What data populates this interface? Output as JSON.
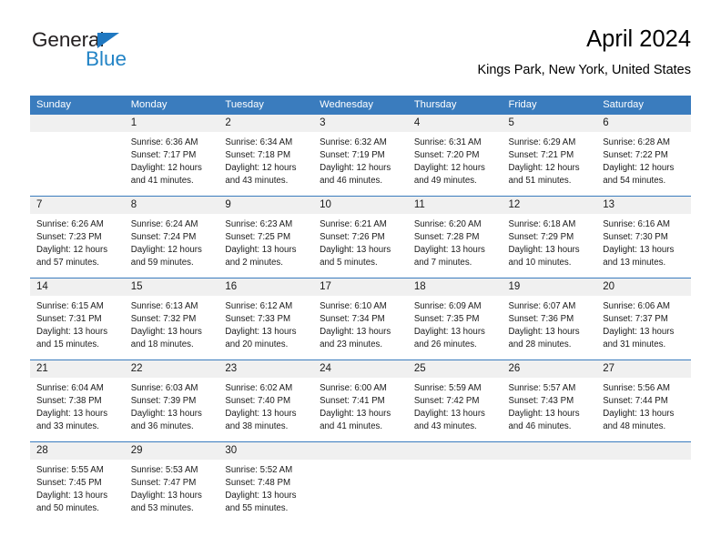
{
  "brand": {
    "name_top": "General",
    "name_bottom": "Blue"
  },
  "header": {
    "title": "April 2024",
    "location": "Kings Park, New York, United States"
  },
  "colors": {
    "header_blue": "#3a7cbe",
    "logo_blue": "#2384c6",
    "daynum_bg": "#f0f0f0"
  },
  "weekday_headers": [
    "Sunday",
    "Monday",
    "Tuesday",
    "Wednesday",
    "Thursday",
    "Friday",
    "Saturday"
  ],
  "weeks": [
    [
      {
        "day": "",
        "sunrise": "",
        "sunset": "",
        "daylight1": "",
        "daylight2": ""
      },
      {
        "day": "1",
        "sunrise": "Sunrise: 6:36 AM",
        "sunset": "Sunset: 7:17 PM",
        "daylight1": "Daylight: 12 hours",
        "daylight2": "and 41 minutes."
      },
      {
        "day": "2",
        "sunrise": "Sunrise: 6:34 AM",
        "sunset": "Sunset: 7:18 PM",
        "daylight1": "Daylight: 12 hours",
        "daylight2": "and 43 minutes."
      },
      {
        "day": "3",
        "sunrise": "Sunrise: 6:32 AM",
        "sunset": "Sunset: 7:19 PM",
        "daylight1": "Daylight: 12 hours",
        "daylight2": "and 46 minutes."
      },
      {
        "day": "4",
        "sunrise": "Sunrise: 6:31 AM",
        "sunset": "Sunset: 7:20 PM",
        "daylight1": "Daylight: 12 hours",
        "daylight2": "and 49 minutes."
      },
      {
        "day": "5",
        "sunrise": "Sunrise: 6:29 AM",
        "sunset": "Sunset: 7:21 PM",
        "daylight1": "Daylight: 12 hours",
        "daylight2": "and 51 minutes."
      },
      {
        "day": "6",
        "sunrise": "Sunrise: 6:28 AM",
        "sunset": "Sunset: 7:22 PM",
        "daylight1": "Daylight: 12 hours",
        "daylight2": "and 54 minutes."
      }
    ],
    [
      {
        "day": "7",
        "sunrise": "Sunrise: 6:26 AM",
        "sunset": "Sunset: 7:23 PM",
        "daylight1": "Daylight: 12 hours",
        "daylight2": "and 57 minutes."
      },
      {
        "day": "8",
        "sunrise": "Sunrise: 6:24 AM",
        "sunset": "Sunset: 7:24 PM",
        "daylight1": "Daylight: 12 hours",
        "daylight2": "and 59 minutes."
      },
      {
        "day": "9",
        "sunrise": "Sunrise: 6:23 AM",
        "sunset": "Sunset: 7:25 PM",
        "daylight1": "Daylight: 13 hours",
        "daylight2": "and 2 minutes."
      },
      {
        "day": "10",
        "sunrise": "Sunrise: 6:21 AM",
        "sunset": "Sunset: 7:26 PM",
        "daylight1": "Daylight: 13 hours",
        "daylight2": "and 5 minutes."
      },
      {
        "day": "11",
        "sunrise": "Sunrise: 6:20 AM",
        "sunset": "Sunset: 7:28 PM",
        "daylight1": "Daylight: 13 hours",
        "daylight2": "and 7 minutes."
      },
      {
        "day": "12",
        "sunrise": "Sunrise: 6:18 AM",
        "sunset": "Sunset: 7:29 PM",
        "daylight1": "Daylight: 13 hours",
        "daylight2": "and 10 minutes."
      },
      {
        "day": "13",
        "sunrise": "Sunrise: 6:16 AM",
        "sunset": "Sunset: 7:30 PM",
        "daylight1": "Daylight: 13 hours",
        "daylight2": "and 13 minutes."
      }
    ],
    [
      {
        "day": "14",
        "sunrise": "Sunrise: 6:15 AM",
        "sunset": "Sunset: 7:31 PM",
        "daylight1": "Daylight: 13 hours",
        "daylight2": "and 15 minutes."
      },
      {
        "day": "15",
        "sunrise": "Sunrise: 6:13 AM",
        "sunset": "Sunset: 7:32 PM",
        "daylight1": "Daylight: 13 hours",
        "daylight2": "and 18 minutes."
      },
      {
        "day": "16",
        "sunrise": "Sunrise: 6:12 AM",
        "sunset": "Sunset: 7:33 PM",
        "daylight1": "Daylight: 13 hours",
        "daylight2": "and 20 minutes."
      },
      {
        "day": "17",
        "sunrise": "Sunrise: 6:10 AM",
        "sunset": "Sunset: 7:34 PM",
        "daylight1": "Daylight: 13 hours",
        "daylight2": "and 23 minutes."
      },
      {
        "day": "18",
        "sunrise": "Sunrise: 6:09 AM",
        "sunset": "Sunset: 7:35 PM",
        "daylight1": "Daylight: 13 hours",
        "daylight2": "and 26 minutes."
      },
      {
        "day": "19",
        "sunrise": "Sunrise: 6:07 AM",
        "sunset": "Sunset: 7:36 PM",
        "daylight1": "Daylight: 13 hours",
        "daylight2": "and 28 minutes."
      },
      {
        "day": "20",
        "sunrise": "Sunrise: 6:06 AM",
        "sunset": "Sunset: 7:37 PM",
        "daylight1": "Daylight: 13 hours",
        "daylight2": "and 31 minutes."
      }
    ],
    [
      {
        "day": "21",
        "sunrise": "Sunrise: 6:04 AM",
        "sunset": "Sunset: 7:38 PM",
        "daylight1": "Daylight: 13 hours",
        "daylight2": "and 33 minutes."
      },
      {
        "day": "22",
        "sunrise": "Sunrise: 6:03 AM",
        "sunset": "Sunset: 7:39 PM",
        "daylight1": "Daylight: 13 hours",
        "daylight2": "and 36 minutes."
      },
      {
        "day": "23",
        "sunrise": "Sunrise: 6:02 AM",
        "sunset": "Sunset: 7:40 PM",
        "daylight1": "Daylight: 13 hours",
        "daylight2": "and 38 minutes."
      },
      {
        "day": "24",
        "sunrise": "Sunrise: 6:00 AM",
        "sunset": "Sunset: 7:41 PM",
        "daylight1": "Daylight: 13 hours",
        "daylight2": "and 41 minutes."
      },
      {
        "day": "25",
        "sunrise": "Sunrise: 5:59 AM",
        "sunset": "Sunset: 7:42 PM",
        "daylight1": "Daylight: 13 hours",
        "daylight2": "and 43 minutes."
      },
      {
        "day": "26",
        "sunrise": "Sunrise: 5:57 AM",
        "sunset": "Sunset: 7:43 PM",
        "daylight1": "Daylight: 13 hours",
        "daylight2": "and 46 minutes."
      },
      {
        "day": "27",
        "sunrise": "Sunrise: 5:56 AM",
        "sunset": "Sunset: 7:44 PM",
        "daylight1": "Daylight: 13 hours",
        "daylight2": "and 48 minutes."
      }
    ],
    [
      {
        "day": "28",
        "sunrise": "Sunrise: 5:55 AM",
        "sunset": "Sunset: 7:45 PM",
        "daylight1": "Daylight: 13 hours",
        "daylight2": "and 50 minutes."
      },
      {
        "day": "29",
        "sunrise": "Sunrise: 5:53 AM",
        "sunset": "Sunset: 7:47 PM",
        "daylight1": "Daylight: 13 hours",
        "daylight2": "and 53 minutes."
      },
      {
        "day": "30",
        "sunrise": "Sunrise: 5:52 AM",
        "sunset": "Sunset: 7:48 PM",
        "daylight1": "Daylight: 13 hours",
        "daylight2": "and 55 minutes."
      },
      {
        "day": "",
        "sunrise": "",
        "sunset": "",
        "daylight1": "",
        "daylight2": ""
      },
      {
        "day": "",
        "sunrise": "",
        "sunset": "",
        "daylight1": "",
        "daylight2": ""
      },
      {
        "day": "",
        "sunrise": "",
        "sunset": "",
        "daylight1": "",
        "daylight2": ""
      },
      {
        "day": "",
        "sunrise": "",
        "sunset": "",
        "daylight1": "",
        "daylight2": ""
      }
    ]
  ]
}
